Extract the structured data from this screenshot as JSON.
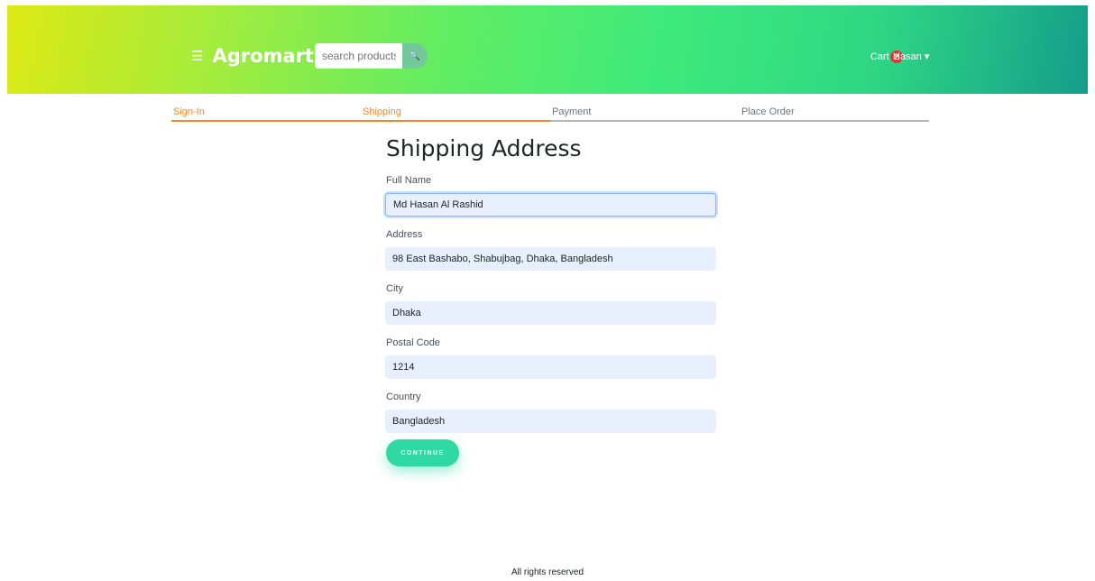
{
  "header": {
    "brand": "Agromart",
    "menu_icon": "☰",
    "search_placeholder": "search products...",
    "search_icon": "🔍",
    "cart_label": "Cart",
    "cart_count": "2",
    "user_name": "Hasan",
    "user_caret": "▾"
  },
  "steps": [
    "Sign-In",
    "Shipping",
    "Payment",
    "Place Order"
  ],
  "form": {
    "title": "Shipping Address",
    "full_name_label": "Full Name",
    "full_name_value": "Md Hasan Al Rashid",
    "address_label": "Address",
    "address_value": "98 East Bashabo, Shabujbag, Dhaka, Bangladesh",
    "city_label": "City",
    "city_value": "Dhaka",
    "postal_code_label": "Postal Code",
    "postal_code_value": "1214",
    "country_label": "Country",
    "country_value": "Bangladesh",
    "continue_label": "CONTINUE"
  },
  "footer": "All rights reserved",
  "colors": {
    "accent": "#ed8a25",
    "button": "#2fd9a2",
    "badge": "#e03636",
    "input_bg": "#e8f0fe"
  }
}
